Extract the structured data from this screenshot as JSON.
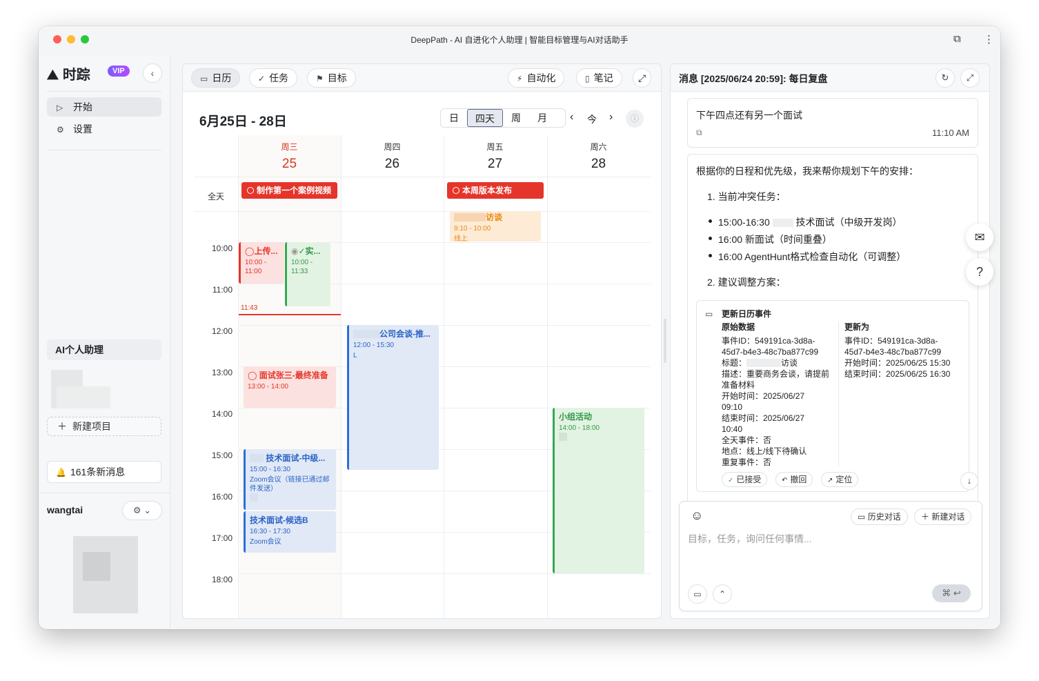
{
  "window": {
    "title": "DeepPath - AI 自进化个人助理 | 智能目标管理与AI对话助手"
  },
  "sidebar": {
    "app_name": "时踪",
    "vip": "VIP",
    "items": [
      {
        "label": "开始",
        "icon": "play-icon"
      },
      {
        "label": "设置",
        "icon": "gear-icon"
      }
    ],
    "ai_section": "AI个人助理",
    "new_project": "新建项目",
    "messages": "161条新消息",
    "username": "wangtai"
  },
  "calendar": {
    "toolbar": {
      "calendar": "日历",
      "tasks": "任务",
      "goals": "目标",
      "automation": "自动化",
      "notes": "笔记"
    },
    "range_title": "6月25日 - 28日",
    "views": [
      "日",
      "四天",
      "周",
      "月"
    ],
    "active_view": "四天",
    "today_btn": "今",
    "days": [
      {
        "weekday": "周三",
        "date": "25",
        "today": true
      },
      {
        "weekday": "周四",
        "date": "26",
        "today": false
      },
      {
        "weekday": "周五",
        "date": "27",
        "today": false
      },
      {
        "weekday": "周六",
        "date": "28",
        "today": false
      }
    ],
    "allday_label": "全天",
    "allday_events": [
      {
        "title": "制作第一个案例视频",
        "day": 0
      },
      {
        "title": "本周版本发布",
        "day": 2
      }
    ],
    "times": [
      "10:00",
      "11:00",
      "12:00",
      "13:00",
      "14:00",
      "15:00",
      "16:00",
      "17:00",
      "18:00"
    ],
    "now_label": "11:43",
    "events": {
      "e_interview_orange": {
        "title": "访谈",
        "time": "9:10 - 10:00",
        "loc": "线上"
      },
      "e_upload": {
        "title": "上传...",
        "time": "10:00 - 11:00"
      },
      "e_real": {
        "title": "✓实...",
        "time": "10:00 - 11:33"
      },
      "e_company": {
        "title": "公司会谈-推...",
        "time": "12:00 - 15:30",
        "extra": "L"
      },
      "e_zhang": {
        "title": "面试张三-最终准备",
        "time": "13:00 - 14:00"
      },
      "e_group": {
        "title": "小组活动",
        "time": "14:00 - 18:00"
      },
      "e_tech1": {
        "title": "技术面试-中级...",
        "time": "15:00 - 16:30",
        "desc": "Zoom会议（链接已通过邮件发送）"
      },
      "e_tech2": {
        "title": "技术面试-候选B",
        "time": "16:30 - 17:30",
        "desc": "Zoom会议"
      }
    }
  },
  "chat": {
    "title": "消息 [2025/06/24 20:59]: 每日复盘",
    "msg1": {
      "text": "下午四点还有另一个面试",
      "time": "11:10 AM"
    },
    "msg2": {
      "intro": "根据你的日程和优先级，我来帮你规划下午的安排：",
      "sec1": "1. 当前冲突任务：",
      "b1_time": "15:00-16:30",
      "b1_text": "技术面试（中级开发岗）",
      "b2": "16:00 新面试（时间重叠）",
      "b3": "16:00 AgentHunt格式检查自动化（可调整）",
      "sec2": "2. 建议调整方案："
    },
    "card": {
      "title": "更新日历事件",
      "orig_h": "原始数据",
      "orig_id": "事件ID：549191ca-3d8a-",
      "orig_id2": "45d7-b4e3-48c7ba877c99",
      "orig_title_label": "标题：",
      "orig_title": "访谈",
      "orig_desc": "描述：重要商务会谈，请提前",
      "orig_desc2": "准备材料",
      "orig_start": "开始时间：2025/06/27",
      "orig_start2": "09:10",
      "orig_end": "结束时间：2025/06/27",
      "orig_end2": "10:40",
      "orig_allday": "全天事件：否",
      "orig_loc": "地点：线上/线下待确认",
      "orig_repeat": "重复事件：否",
      "new_h": "更新为",
      "new_id": "事件ID：549191ca-3d8a-",
      "new_id2": "45d7-b4e3-48c7ba877c99",
      "new_start": "开始时间：2025/06/25 15:30",
      "new_end": "结束时间：2025/06/25 16:30",
      "accepted": "已接受",
      "undo": "撤回",
      "locate": "定位"
    },
    "input": {
      "history": "历史对话",
      "new_chat": "新建对话",
      "placeholder": "目标，任务，询问任何事情...",
      "send": "⌘ ↩"
    }
  }
}
